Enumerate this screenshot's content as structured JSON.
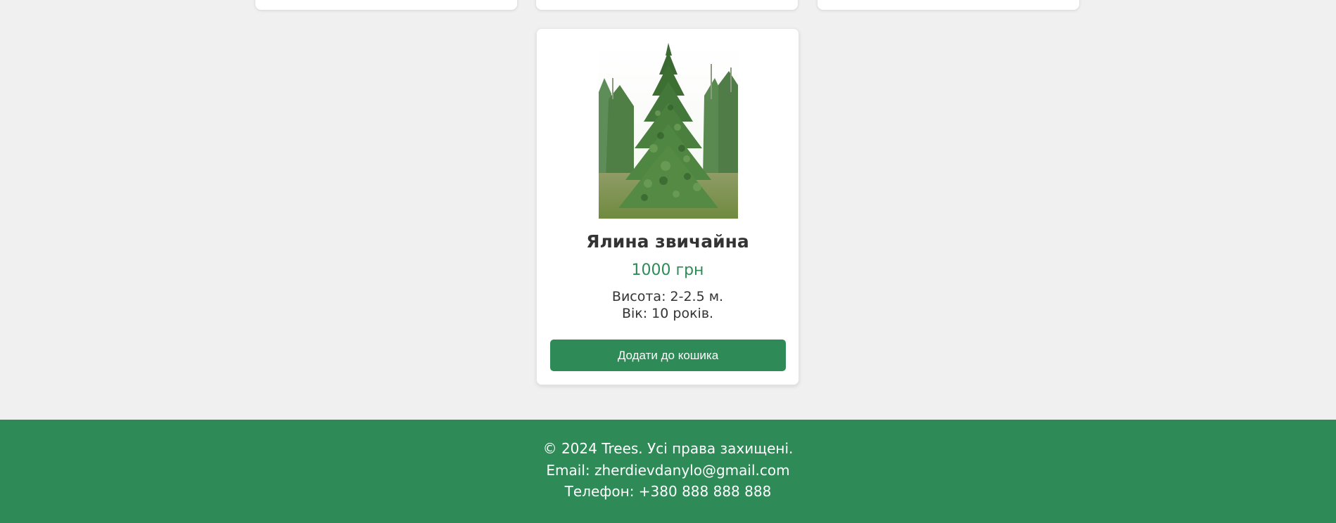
{
  "product": {
    "image_alt": "Ялина звичайна",
    "title": "Ялина звичайна",
    "price": "1000 грн",
    "height": "Висота: 2-2.5 м.",
    "age": "Вік: 10 років.",
    "button_label": "Додати до кошика"
  },
  "footer": {
    "copyright": "© 2024 Trees. Усі права захищені.",
    "email": "Email: zherdievdanylo@gmail.com",
    "phone": "Телефон: +380 888 888 888"
  },
  "colors": {
    "accent": "#2e8b57",
    "background": "#f0f0f0",
    "card": "#ffffff",
    "text": "#333333"
  }
}
